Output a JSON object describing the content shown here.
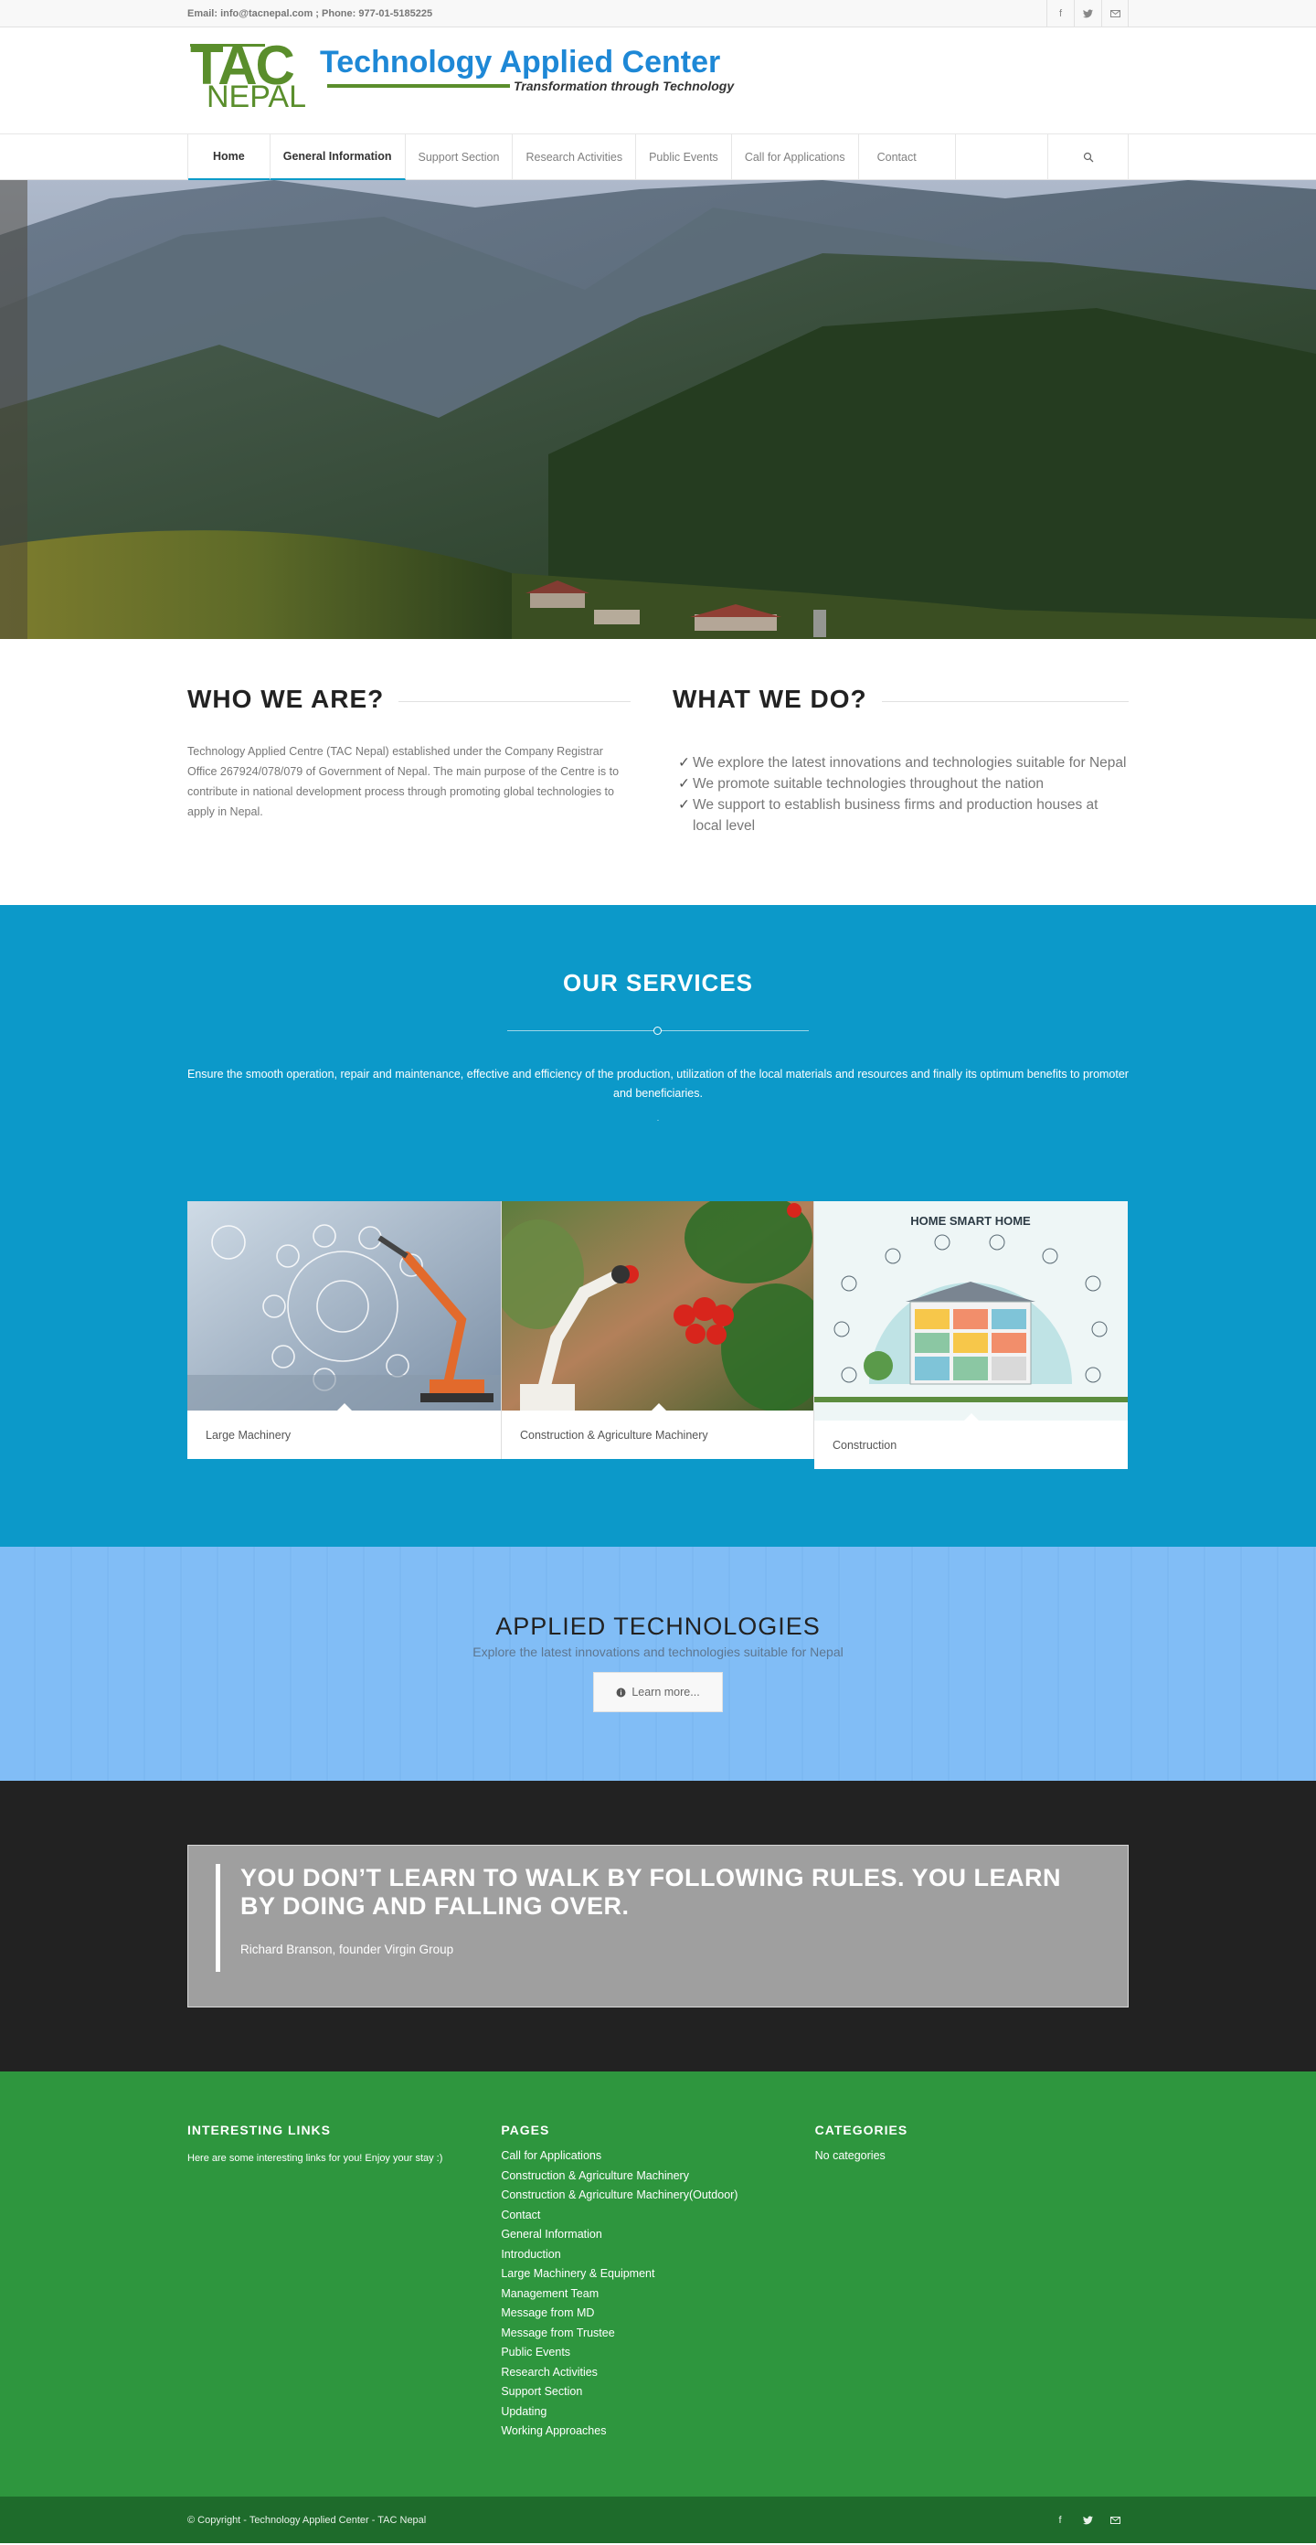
{
  "topbar": {
    "contact": "Email: info@tacnepal.com ; Phone: 977-01-5185225",
    "social": [
      "facebook-icon",
      "twitter-icon",
      "mail-icon"
    ]
  },
  "logo": {
    "tac": "TAC",
    "nepal": "NEPAL",
    "title": "Technology Applied Center",
    "tagline": "Transformation through Technology"
  },
  "nav": {
    "items": [
      "Home",
      "General Information",
      "Support Section",
      "Research Activities",
      "Public Events",
      "Call for Applications",
      "Contact"
    ],
    "search_icon": "search-icon"
  },
  "about": {
    "who_title": "WHO WE ARE?",
    "who_text": "Technology Applied Centre (TAC Nepal) established under the Company Registrar Office 267924/078/079 of Government of Nepal. The main purpose of the Centre is to contribute in national development process through promoting global technologies to apply in Nepal.",
    "what_title": "WHAT WE DO?",
    "what_items": [
      "We explore the latest innovations and technologies suitable for Nepal",
      "We promote suitable technologies throughout the nation",
      "We support to establish business firms and production houses at local level"
    ]
  },
  "services": {
    "title": "OUR SERVICES",
    "intro": "Ensure the smooth operation, repair and maintenance, effective and efficiency of the production, utilization of the local materials and resources and finally its optimum benefits to promoter and beneficiaries.",
    "dot": ".",
    "cards": [
      {
        "label": "Large Machinery"
      },
      {
        "label": "Construction & Agriculture Machinery"
      },
      {
        "label": "Construction",
        "image_title": "HOME SMART HOME"
      }
    ]
  },
  "applied": {
    "title": "APPLIED TECHNOLOGIES",
    "subtitle": "Explore the latest innovations and technologies suitable for Nepal",
    "button": "Learn more..."
  },
  "quote": {
    "text": "YOU DON’T LEARN TO WALK BY FOLLOWING RULES. YOU LEARN BY DOING AND FALLING OVER.",
    "author": "Richard Branson, founder Virgin Group"
  },
  "footer": {
    "links_title": "INTERESTING LINKS",
    "links_note": "Here are some interesting links for you! Enjoy your stay :)",
    "pages_title": "PAGES",
    "pages": [
      "Call for Applications",
      "Construction & Agriculture Machinery",
      "Construction & Agriculture Machinery(Outdoor)",
      "Contact",
      "General Information",
      "Introduction",
      "Large Machinery & Equipment",
      "Management Team",
      "Message from MD",
      "Message from Trustee",
      "Public Events",
      "Research Activities",
      "Support Section",
      "Updating",
      "Working Approaches"
    ],
    "categories_title": "CATEGORIES",
    "categories_note": "No categories"
  },
  "bottom": {
    "copyright": "© Copyright - Technology Applied Center - TAC Nepal"
  },
  "colors": {
    "accent": "#0c99c9",
    "footer_green": "#2e963e",
    "bottom_green": "#1e6b2b",
    "logo_blue": "#1e88d6",
    "logo_green": "#5a8e2c"
  }
}
